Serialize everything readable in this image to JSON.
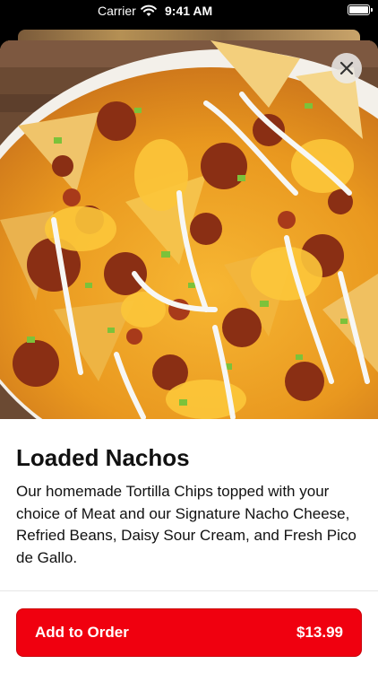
{
  "status_bar": {
    "carrier": "Carrier",
    "time": "9:41 AM",
    "icons": [
      "wifi-icon",
      "battery-icon"
    ]
  },
  "item": {
    "title": "Loaded Nachos",
    "description": "Our homemade Tortilla Chips topped with your choice of Meat and our Signature Nacho Cheese, Refried Beans, Daisy Sour Cream, and Fresh Pico de Gallo.",
    "image_icon": "nachos-photo"
  },
  "close_icon": "close-icon",
  "order_button": {
    "label": "Add to Order",
    "price": "$13.99"
  },
  "colors": {
    "accent": "#f0000f",
    "text": "#111111",
    "background": "#ffffff"
  }
}
